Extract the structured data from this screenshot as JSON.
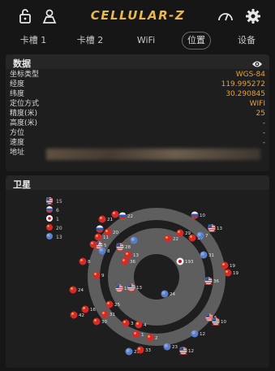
{
  "app": {
    "title": "CELLULAR-Z"
  },
  "tabs": [
    {
      "label": "卡槽 1"
    },
    {
      "label": "卡槽 2"
    },
    {
      "label": "WiFi"
    },
    {
      "label": "位置",
      "active": true
    },
    {
      "label": "设备"
    }
  ],
  "data_card": {
    "title": "数据",
    "rows": [
      {
        "key": "坐标类型",
        "value": "WGS-84"
      },
      {
        "key": "经度",
        "value": "119.995272"
      },
      {
        "key": "纬度",
        "value": "30.290845"
      },
      {
        "key": "定位方式",
        "value": "WIFI"
      },
      {
        "key": "精度(米)",
        "value": "25"
      },
      {
        "key": "高度(米)",
        "value": "-"
      },
      {
        "key": "方位",
        "value": "-"
      },
      {
        "key": "速度",
        "value": "-"
      },
      {
        "key": "地址",
        "value": ""
      }
    ]
  },
  "satellite_card": {
    "title": "卫星",
    "legend": [
      {
        "flag": "usa",
        "count": "15"
      },
      {
        "flag": "russia",
        "count": "6"
      },
      {
        "flag": "japan",
        "count": "1"
      },
      {
        "flag": "china",
        "count": "20"
      },
      {
        "flag": "eu",
        "count": "13"
      }
    ],
    "satellites": [
      {
        "flag": "russia",
        "label": "10"
      },
      {
        "flag": "usa",
        "label": "13"
      },
      {
        "flag": "china",
        "label": "26"
      },
      {
        "flag": "russia",
        "label": "22"
      },
      {
        "flag": "china",
        "label": "21"
      },
      {
        "flag": "russia",
        "label": ""
      },
      {
        "flag": "china",
        "label": "20"
      },
      {
        "flag": "china",
        "label": "11"
      },
      {
        "flag": "usa",
        "label": "5"
      },
      {
        "flag": "usa",
        "label": "28"
      },
      {
        "flag": "eu",
        "label": ""
      },
      {
        "flag": "eu",
        "label": "8"
      },
      {
        "flag": "china",
        "label": "22"
      },
      {
        "flag": "china",
        "label": "29"
      },
      {
        "flag": "china",
        "label": "14"
      },
      {
        "flag": "eu",
        "label": "7"
      },
      {
        "flag": "eu",
        "label": "31"
      },
      {
        "flag": "china",
        "label": "6"
      },
      {
        "flag": "china",
        "label": "13"
      },
      {
        "flag": "japan",
        "label": "193"
      },
      {
        "flag": "china",
        "label": "36"
      },
      {
        "flag": "china",
        "label": "19"
      },
      {
        "flag": "china",
        "label": "8"
      },
      {
        "flag": "china",
        "label": "9"
      },
      {
        "flag": "usa",
        "label": "15"
      },
      {
        "flag": "usa",
        "label": "13"
      },
      {
        "flag": "eu",
        "label": "24"
      },
      {
        "flag": "china",
        "label": "16"
      },
      {
        "flag": "china",
        "label": "25"
      },
      {
        "flag": "china",
        "label": "31"
      },
      {
        "flag": "china",
        "label": "30"
      },
      {
        "flag": "china",
        "label": "42"
      },
      {
        "flag": "china",
        "label": "24"
      },
      {
        "flag": "china",
        "label": "1"
      },
      {
        "flag": "china",
        "label": "2"
      },
      {
        "flag": "usa",
        "label": "5"
      },
      {
        "flag": "china",
        "label": "3"
      },
      {
        "flag": "china",
        "label": "4"
      },
      {
        "flag": "eu",
        "label": "12"
      },
      {
        "flag": "eu",
        "label": "23"
      },
      {
        "flag": "usa",
        "label": "12"
      },
      {
        "flag": "usa",
        "label": "10"
      },
      {
        "flag": "eu",
        "label": "25"
      },
      {
        "flag": "china",
        "label": "33"
      },
      {
        "flag": "china",
        "label": "19"
      },
      {
        "flag": "usa",
        "label": "36"
      }
    ]
  }
}
